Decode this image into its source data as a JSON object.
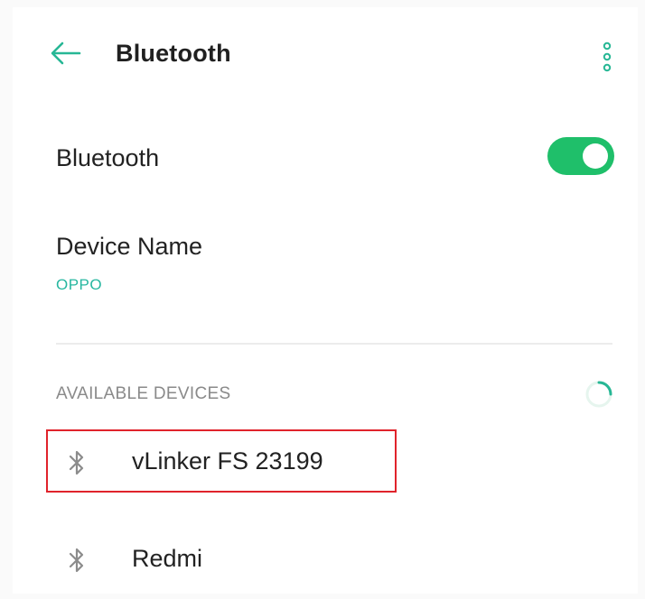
{
  "header": {
    "title": "Bluetooth",
    "back_icon": "arrow-left-icon",
    "more_icon": "more-vertical-icon"
  },
  "bluetooth_toggle": {
    "label": "Bluetooth",
    "state": "on",
    "color": "#1fbf6a"
  },
  "device_name": {
    "label": "Device Name",
    "value": "OPPO",
    "value_color": "#27b7a0"
  },
  "available_devices": {
    "section_label": "AVAILABLE DEVICES",
    "loading_icon": "spinner-icon",
    "items": [
      {
        "label": "vLinker FS 23199",
        "icon": "bluetooth-icon"
      },
      {
        "label": "Redmi",
        "icon": "bluetooth-icon"
      }
    ]
  },
  "highlight_color": "#e0232b"
}
